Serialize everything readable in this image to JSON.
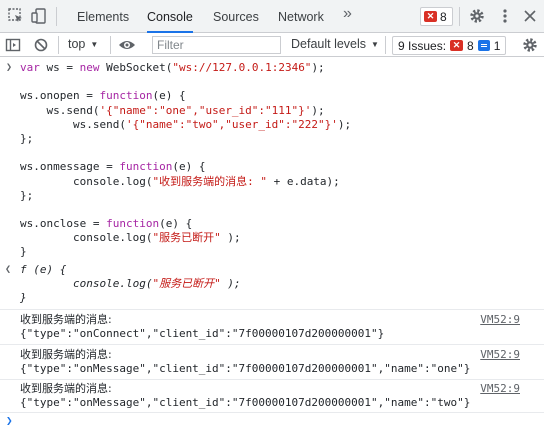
{
  "tabs": [
    "Elements",
    "Console",
    "Sources",
    "Network"
  ],
  "active_tab": "Console",
  "error_count": "8",
  "toolbar": {
    "context": "top",
    "filter_placeholder": "Filter",
    "levels": "Default levels",
    "issues_label": "9 Issues:",
    "issues_errors": "8",
    "issues_info": "1"
  },
  "code_lines": [
    "var ws = new WebSocket(\"ws://127.0.0.1:2346\");",
    "",
    "ws.onopen = function(e) {",
    "    ws.send('{\"name\":\"one\",\"user_id\":\"111\"}');",
    "        ws.send('{\"name\":\"two\",\"user_id\":\"222\"}');",
    "};",
    "",
    "ws.onmessage = function(e) {",
    "        console.log(\"收到服务端的消息: \" + e.data);",
    "};",
    "",
    "ws.onclose = function(e) {",
    "        console.log(\"服务已断开\" );",
    "}"
  ],
  "result_lines": [
    "f (e) {",
    "        console.log(\"服务已断开\" );",
    "}"
  ],
  "messages": [
    {
      "label": "收到服务端的消息:",
      "data": "{\"type\":\"onConnect\",\"client_id\":\"7f00000107d200000001\"}",
      "source": "VM52:9"
    },
    {
      "label": "收到服务端的消息:",
      "data": "{\"type\":\"onMessage\",\"client_id\":\"7f00000107d200000001\",\"name\":\"one\"}",
      "source": "VM52:9"
    },
    {
      "label": "收到服务端的消息:",
      "data": "{\"type\":\"onMessage\",\"client_id\":\"7f00000107d200000001\",\"name\":\"two\"}",
      "source": "VM52:9"
    }
  ]
}
